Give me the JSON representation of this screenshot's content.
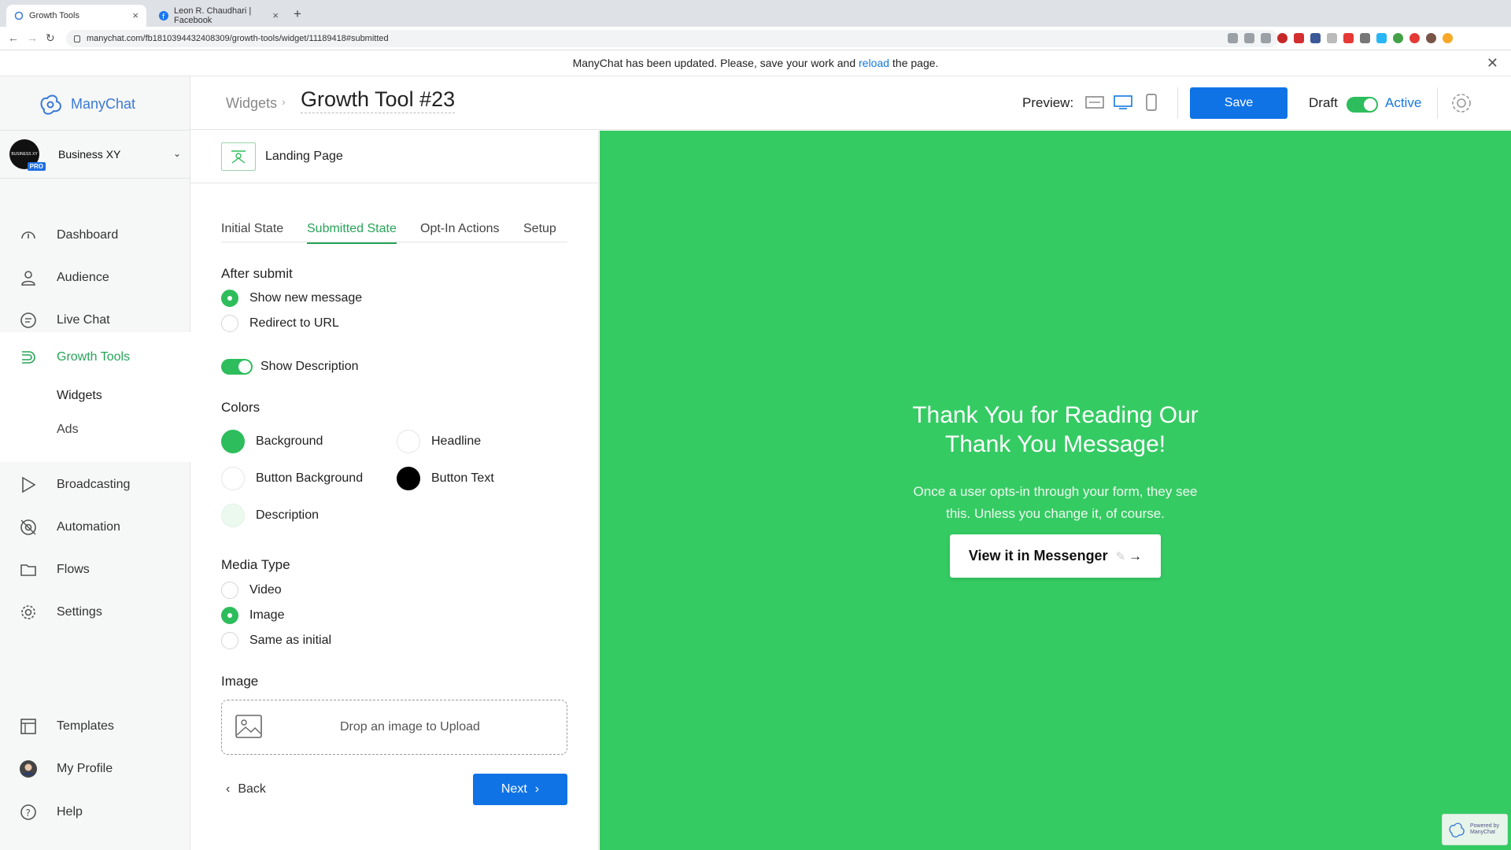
{
  "browser": {
    "tabs": [
      {
        "title": "Growth Tools",
        "active": true
      },
      {
        "title": "Leon R. Chaudhari | Facebook",
        "active": false
      }
    ],
    "url": "manychat.com/fb181039443240830​9/growth-tools/widget/11189418#submitted",
    "new_tab": "+",
    "tab_close": "×"
  },
  "notice": {
    "before": "ManyChat has been updated. Please, save your work and",
    "link": "reload",
    "after": "the page.",
    "close": "✕"
  },
  "sidebar": {
    "brand": "ManyChat",
    "account": {
      "name": "Business XY",
      "avatar_text": "BUSINESS XY",
      "badge": "PRO"
    },
    "items": [
      {
        "label": "Dashboard",
        "icon": "dashboard-icon"
      },
      {
        "label": "Audience",
        "icon": "person-icon"
      },
      {
        "label": "Live Chat",
        "icon": "chat-icon"
      },
      {
        "label": "Growth Tools",
        "icon": "growth-tools-icon",
        "active": true
      },
      {
        "label": "Broadcasting",
        "icon": "broadcast-icon"
      },
      {
        "label": "Automation",
        "icon": "automation-icon"
      },
      {
        "label": "Flows",
        "icon": "folder-icon"
      },
      {
        "label": "Settings",
        "icon": "gear-icon"
      },
      {
        "label": "Templates",
        "icon": "templates-icon"
      },
      {
        "label": "My Profile",
        "icon": "avatar-icon"
      },
      {
        "label": "Help",
        "icon": "help-icon"
      }
    ],
    "growth_sub": [
      "Widgets",
      "Ads"
    ]
  },
  "header": {
    "breadcrumb": "Widgets",
    "title": "Growth Tool #23",
    "preview_label": "Preview:",
    "save_label": "Save",
    "draft_label": "Draft",
    "active_label": "Active"
  },
  "panel": {
    "widget_type": "Landing Page",
    "tabs": [
      "Initial State",
      "Submitted State",
      "Opt-In Actions",
      "Setup"
    ],
    "active_tab": "Submitted State",
    "after_submit": {
      "title": "After submit",
      "options": [
        "Show new message",
        "Redirect to URL"
      ],
      "selected": "Show new message"
    },
    "show_description": "Show Description",
    "colors": {
      "title": "Colors",
      "items": [
        {
          "label": "Background",
          "color": "#2ebd5c"
        },
        {
          "label": "Headline",
          "color": "#ffffff"
        },
        {
          "label": "Button Background",
          "color": "#ffffff"
        },
        {
          "label": "Button Text",
          "color": "#000000"
        },
        {
          "label": "Description",
          "color": "#ebf9ee"
        }
      ]
    },
    "media_type": {
      "title": "Media Type",
      "options": [
        "Video",
        "Image",
        "Same as initial"
      ],
      "selected": "Image"
    },
    "image": {
      "title": "Image",
      "drop_text": "Drop an image to Upload"
    },
    "back_label": "Back",
    "next_label": "Next"
  },
  "preview": {
    "headline_line1": "Thank You for Reading Our",
    "headline_line2": "Thank You Message!",
    "desc_line1": "Once a user opts-in through your form, they see",
    "desc_line2": "this. Unless you change it, of course.",
    "button_label": "View it in Messenger",
    "background": "#35cb63",
    "badge_line1": "Powered by",
    "badge_line2": "ManyChat"
  },
  "colors": {
    "accent_green": "#28a359",
    "brand_blue": "#0f73e6",
    "link_blue": "#1479e0"
  }
}
